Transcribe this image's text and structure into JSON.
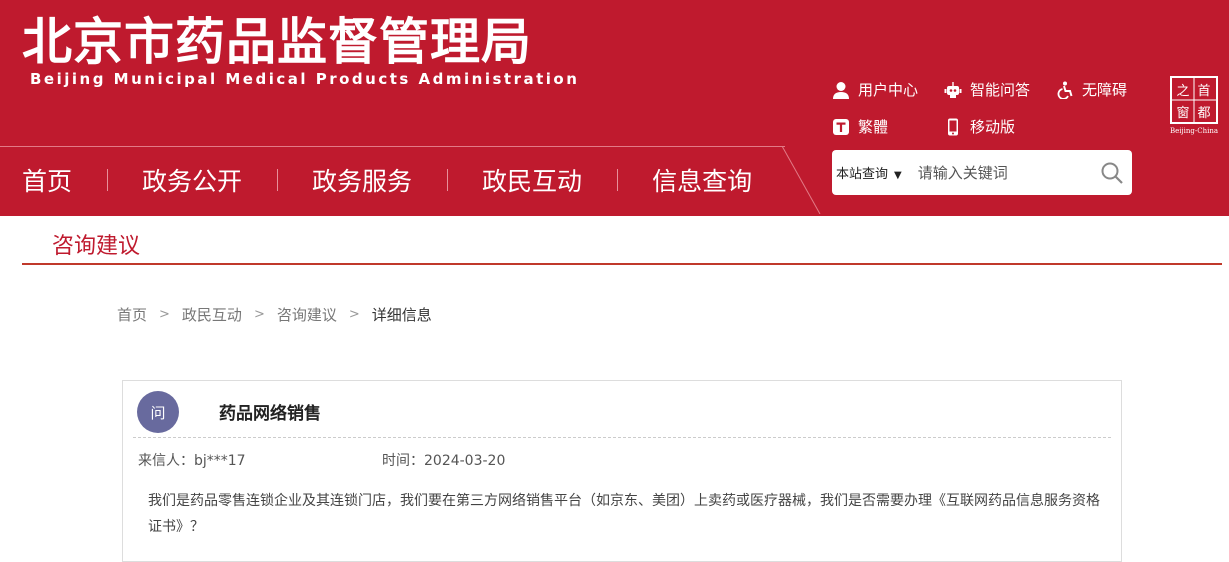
{
  "header": {
    "title_cn": "北京市药品监督管理局",
    "title_en": "Beijing Municipal Medical Products Administration",
    "brand_color": "#bf1a2e"
  },
  "utility_links": {
    "user_center": "用户中心",
    "smart_qa": "智能问答",
    "accessibility": "无障碍",
    "traditional": "繁體",
    "mobile": "移动版"
  },
  "seal": {
    "chars": [
      "首",
      "都",
      "之",
      "窗"
    ],
    "caption": "Beijing-China"
  },
  "nav": {
    "items": [
      "首页",
      "政务公开",
      "政务服务",
      "政民互动",
      "信息查询"
    ]
  },
  "search": {
    "scope_label": "本站查询",
    "placeholder": "请输入关键词"
  },
  "section": {
    "title": "咨询建议"
  },
  "breadcrumb": [
    "首页",
    "政民互动",
    "咨询建议",
    "详细信息"
  ],
  "question": {
    "badge": "问",
    "title": "药品网络销售",
    "sender": "来信人：bj***17",
    "time": "时间：2024-03-20",
    "body": "我们是药品零售连锁企业及其连锁门店，我们要在第三方网络销售平台（如京东、美团）上卖药或医疗器械，我们是否需要办理《互联网药品信息服务资格证书》？"
  }
}
